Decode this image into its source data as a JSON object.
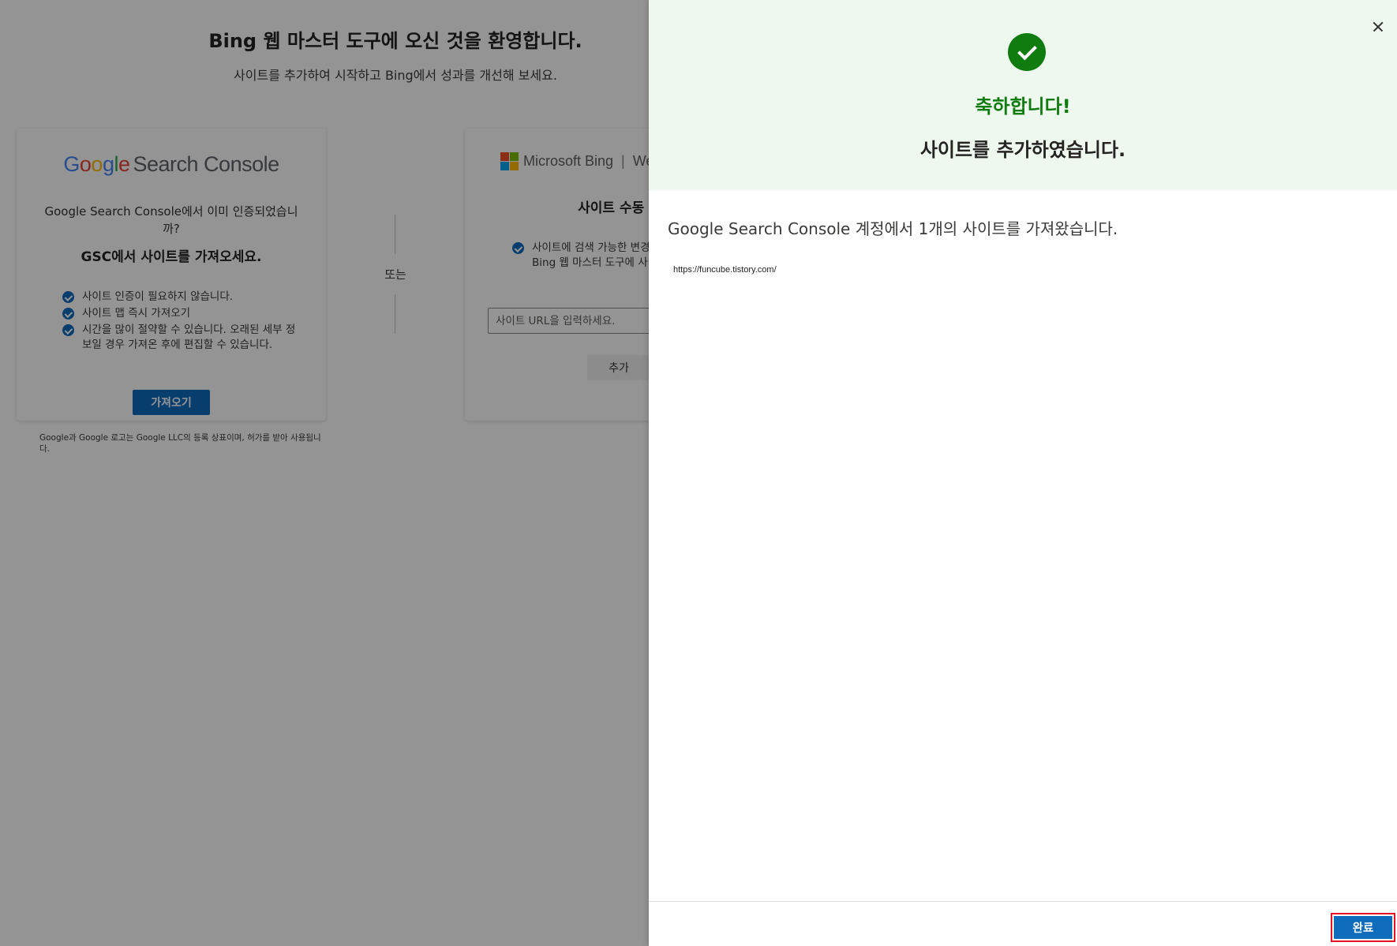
{
  "background": {
    "welcome_title": "Bing 웹 마스터 도구에 오신 것을 환영합니다.",
    "welcome_subtitle": "사이트를 추가하여 시작하고 Bing에서 성과를 개선해 보세요.",
    "gsc_card": {
      "logo_google": [
        "G",
        "o",
        "o",
        "g",
        "l",
        "e"
      ],
      "logo_product": "Search Console",
      "question": "Google Search Console에서 이미 인증되었습니까?",
      "heading": "GSC에서 사이트를 가져오세요.",
      "benefits": [
        "사이트 인증이 필요하지 않습니다.",
        "사이트 맵 즉시 가져오기",
        "시간을 많이 절약할 수 있습니다. 오래된 세부 정보일 경우 가져온 후에 편집할 수 있습니다."
      ],
      "import_button": "가져오기",
      "disclaimer": "Google과 Google 로고는 Google LLC의 등록 상표이며, 허가를 받아 사용됩니다."
    },
    "or_text": "또는",
    "bing_card": {
      "logo_text": "Microsoft Bing",
      "logo_suffix": "We",
      "logo_colors": [
        "#f25022",
        "#7fba00",
        "#00a4ef",
        "#ffb900"
      ],
      "heading": "사이트 수동 추",
      "benefits": [
        "사이트에 검색 가능한 변경 내용이 있는 경우 Bing 웹 마스터 도구에 사이트를 추가하세요."
      ],
      "url_placeholder": "사이트 URL을 입력하세요.",
      "add_button": "추가"
    }
  },
  "panel": {
    "congrats": "축하합니다!",
    "added_title": "사이트를 추가하였습니다.",
    "imported_message": "Google Search Console 계정에서 1개의 사이트를 가져왔습니다.",
    "sites": [
      "https://funcube.tistory.com/"
    ],
    "done_button": "완료"
  },
  "colors": {
    "accent": "#0f6cbd",
    "success": "#107c10",
    "panel_header_bg": "#eff8ef",
    "highlight_border": "#e81123"
  },
  "icons": {
    "close": "close-icon",
    "success": "success-check-icon",
    "check": "check-circle-icon"
  }
}
